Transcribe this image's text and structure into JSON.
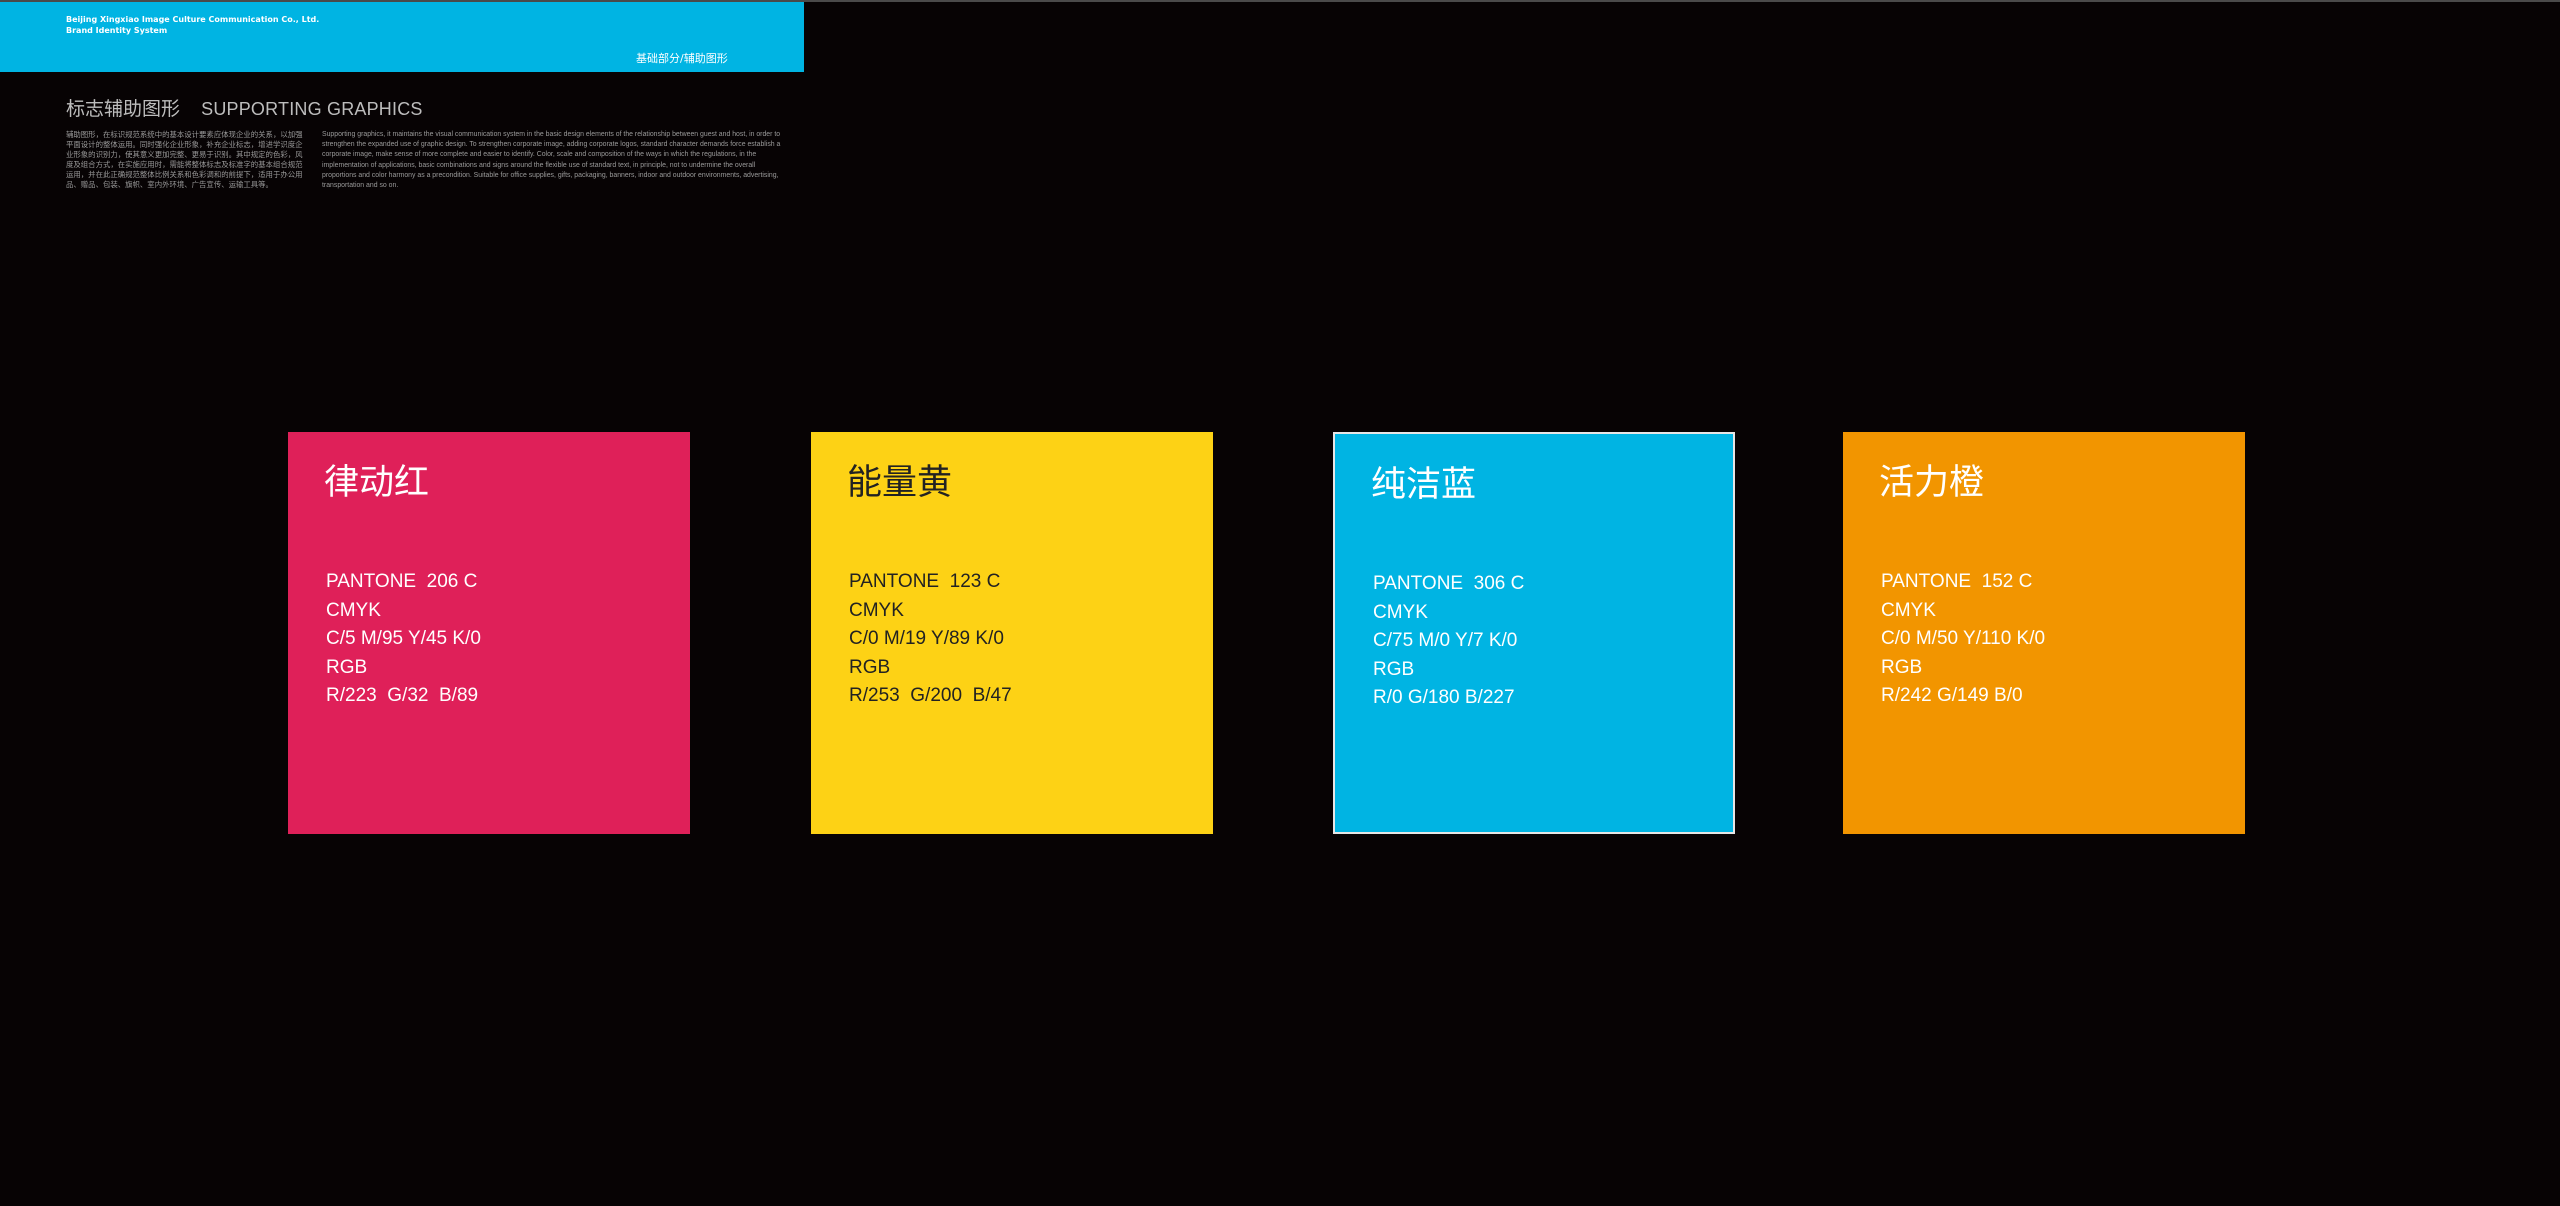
{
  "header": {
    "company_line1": "Beijing Xingxiao Image Culture Communication Co., Ltd.",
    "company_line2": "Brand Identity System",
    "section": "基础部分/辅助图形",
    "color": "#00b4e3"
  },
  "heading": {
    "title_cn": "标志辅助图形",
    "title_en": "SUPPORTING GRAPHICS"
  },
  "description": {
    "cn": "辅助图形，在标识规范系统中的基本设计要素应体现企业的关系，以加强平面设计的整体运用。同时强化企业形象，补充企业标志，增进学识度企业形象的识别力，使其意义更加完整、更易于识别。其中规定的色彩，风度及组合方式，在实施应用时，需能将整体标志及标准字的基本组合规范运用，并在此正确规范整体比例关系和色彩调和的前提下，适用于办公用品、赠品、包装、旗帜、室内外环境、广告宣传、运输工具等。",
    "en": "Supporting graphics, it maintains the visual communication system in the basic design elements of the relationship between guest and host, in order to strengthen the expanded use of graphic design. To strengthen corporate image, adding corporate logos, standard character demands force establish a corporate image, make sense of more complete and easier to identify. Color, scale and composition of the ways in which the regulations, in the implementation of applications, basic combinations and signs around the flexible use of standard text, in principle, not to undermine the overall proportions and color harmony as a precondition. Suitable for office supplies, gifts, packaging, banners, indoor and outdoor environments, advertising, transportation and so on."
  },
  "swatches": [
    {
      "name": "律动红",
      "pantone": "PANTONE  206 C",
      "cmyk_label": "CMYK",
      "cmyk": "C/5 M/95 Y/45 K/0",
      "rgb_label": "RGB",
      "rgb": "R/223  G/32  B/89",
      "color": "#df2059"
    },
    {
      "name": "能量黄",
      "pantone": "PANTONE  123 C",
      "cmyk_label": "CMYK",
      "cmyk": "C/0 M/19 Y/89 K/0",
      "rgb_label": "RGB",
      "rgb": "R/253  G/200  B/47",
      "color": "#fdd215"
    },
    {
      "name": "纯洁蓝",
      "pantone": "PANTONE  306 C",
      "cmyk_label": "CMYK",
      "cmyk": "C/75 M/0 Y/7 K/0",
      "rgb_label": "RGB",
      "rgb": "R/0 G/180 B/227",
      "color": "#00b4e3"
    },
    {
      "name": "活力橙",
      "pantone": "PANTONE  152 C",
      "cmyk_label": "CMYK",
      "cmyk": "C/0 M/50 Y/110 K/0",
      "rgb_label": "RGB",
      "rgb": "R/242 G/149 B/0",
      "color": "#f29500"
    }
  ]
}
